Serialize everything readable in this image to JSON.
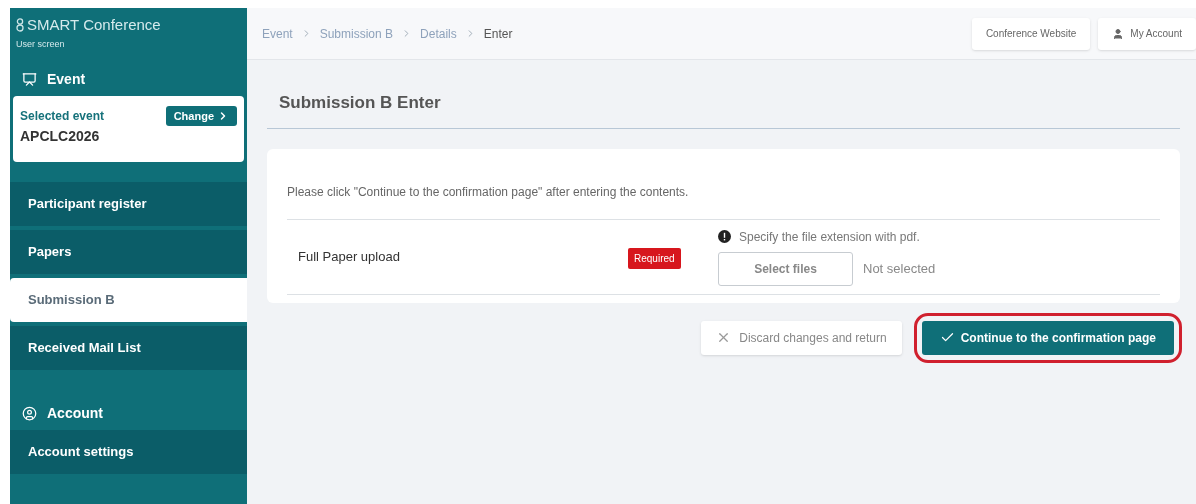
{
  "brand": {
    "title": "SMART Conference",
    "subtitle": "User screen"
  },
  "event_section": {
    "title": "Event",
    "selected_label": "Selected event",
    "event_name": "APCLC2026",
    "change_button": "Change"
  },
  "nav_items": [
    {
      "label": "Participant register",
      "selected": false
    },
    {
      "label": "Papers",
      "selected": false
    },
    {
      "label": "Submission B",
      "selected": true
    },
    {
      "label": "Received Mail List",
      "selected": false
    }
  ],
  "account_section": {
    "title": "Account",
    "items": [
      {
        "label": "Account settings",
        "selected": false
      }
    ]
  },
  "breadcrumb": [
    {
      "label": "Event",
      "current": false
    },
    {
      "label": "Submission B",
      "current": false
    },
    {
      "label": "Details",
      "current": false
    },
    {
      "label": "Enter",
      "current": true
    }
  ],
  "header_buttons": {
    "website": "Conference Website",
    "account": "My Account"
  },
  "page_title": "Submission B Enter",
  "instruction": "Please click \"Continue to the confirmation page\" after entering the contents.",
  "form_rows": [
    {
      "label": "Full Paper upload",
      "badge": "Required",
      "required": true,
      "hint": "Specify the file extension with pdf.",
      "button": "Select files",
      "file_status": "Not selected"
    }
  ],
  "actions": {
    "discard": "Discard changes and return",
    "continue": "Continue to the confirmation page",
    "continue_highlighted": true
  }
}
